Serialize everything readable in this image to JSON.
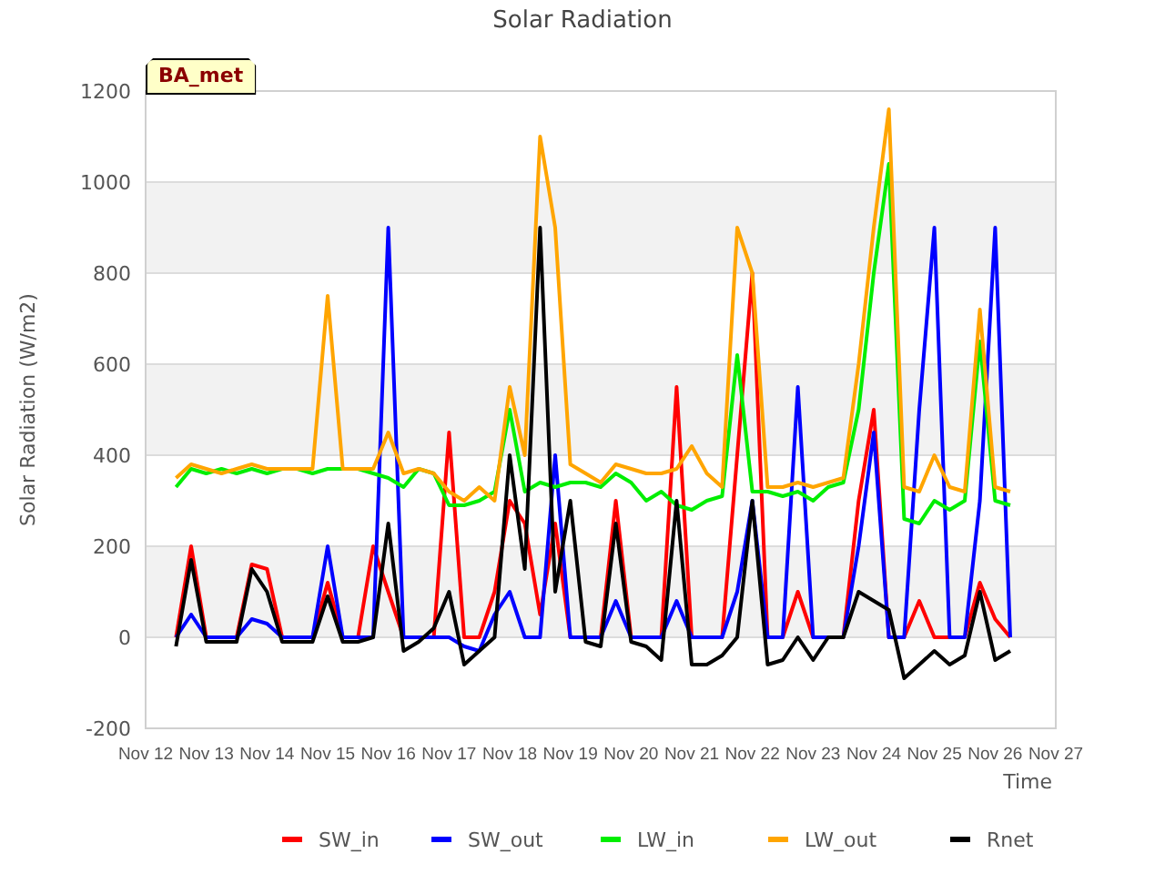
{
  "site_tag": "BA_met",
  "chart_data": {
    "type": "line",
    "title": "Solar Radiation",
    "xlabel": "Time",
    "ylabel": "Solar Radiation (W/m2)",
    "categories": [
      "Nov 12",
      null,
      null,
      null,
      "Nov 13",
      null,
      null,
      null,
      "Nov 14",
      null,
      null,
      null,
      "Nov 15",
      null,
      null,
      null,
      "Nov 16",
      null,
      null,
      null,
      "Nov 17",
      null,
      null,
      null,
      "Nov 18",
      null,
      null,
      null,
      "Nov 19",
      null,
      null,
      null,
      "Nov 20",
      null,
      null,
      null,
      "Nov 21",
      null,
      null,
      null,
      "Nov 22",
      null,
      null,
      null,
      "Nov 23",
      null,
      null,
      null,
      "Nov 24",
      null,
      null,
      null,
      "Nov 25",
      null,
      null,
      null,
      "Nov 26",
      null,
      null,
      null,
      "Nov 27"
    ],
    "series": [
      {
        "name": "SW_in",
        "color": "#ff0000",
        "values": [
          null,
          null,
          0,
          200,
          0,
          0,
          0,
          160,
          150,
          0,
          0,
          0,
          120,
          0,
          0,
          200,
          100,
          0,
          0,
          0,
          450,
          0,
          0,
          100,
          300,
          250,
          50,
          250,
          0,
          0,
          0,
          300,
          0,
          0,
          0,
          550,
          0,
          0,
          0,
          400,
          800,
          0,
          0,
          100,
          0,
          0,
          0,
          300,
          500,
          0,
          0,
          80,
          0,
          0,
          0,
          120,
          40,
          0,
          null,
          null,
          null
        ]
      },
      {
        "name": "SW_out",
        "color": "#0000ff",
        "values": [
          null,
          null,
          0,
          50,
          0,
          0,
          0,
          40,
          30,
          0,
          0,
          0,
          200,
          0,
          0,
          0,
          900,
          0,
          0,
          0,
          0,
          -20,
          -30,
          50,
          100,
          0,
          0,
          400,
          0,
          0,
          0,
          80,
          0,
          0,
          0,
          80,
          0,
          0,
          0,
          100,
          300,
          0,
          0,
          550,
          0,
          0,
          0,
          200,
          450,
          0,
          0,
          500,
          900,
          0,
          0,
          300,
          900,
          0,
          null,
          null,
          null
        ]
      },
      {
        "name": "LW_in",
        "color": "#00ee00",
        "values": [
          null,
          null,
          330,
          370,
          360,
          370,
          360,
          370,
          360,
          370,
          370,
          360,
          370,
          370,
          370,
          360,
          350,
          330,
          370,
          360,
          290,
          290,
          300,
          320,
          500,
          320,
          340,
          330,
          340,
          340,
          330,
          360,
          340,
          300,
          320,
          290,
          280,
          300,
          310,
          620,
          320,
          320,
          310,
          320,
          300,
          330,
          340,
          500,
          800,
          1040,
          260,
          250,
          300,
          280,
          300,
          650,
          300,
          290,
          null,
          null,
          null
        ]
      },
      {
        "name": "LW_out",
        "color": "#ffa500",
        "values": [
          null,
          null,
          350,
          380,
          370,
          360,
          370,
          380,
          370,
          370,
          370,
          370,
          750,
          370,
          370,
          370,
          450,
          360,
          370,
          360,
          320,
          300,
          330,
          300,
          550,
          400,
          1100,
          900,
          380,
          360,
          340,
          380,
          370,
          360,
          360,
          370,
          420,
          360,
          330,
          900,
          800,
          330,
          330,
          340,
          330,
          340,
          350,
          600,
          900,
          1160,
          330,
          320,
          400,
          330,
          320,
          720,
          330,
          320,
          null,
          null,
          null
        ]
      },
      {
        "name": "Rnet",
        "color": "#000000",
        "values": [
          null,
          null,
          -20,
          170,
          -10,
          -10,
          -10,
          150,
          100,
          -10,
          -10,
          -10,
          90,
          -10,
          -10,
          0,
          250,
          -30,
          -10,
          20,
          100,
          -60,
          -30,
          0,
          400,
          150,
          900,
          100,
          300,
          -10,
          -20,
          250,
          -10,
          -20,
          -50,
          300,
          -60,
          -60,
          -40,
          0,
          300,
          -60,
          -50,
          0,
          -50,
          0,
          0,
          100,
          80,
          60,
          -90,
          -60,
          -30,
          -60,
          -40,
          100,
          -50,
          -30,
          null,
          null,
          null
        ]
      }
    ],
    "grid": true,
    "legend": "bottom",
    "ylim": [
      -200,
      1200
    ],
    "yticks": [
      -200,
      0,
      200,
      400,
      600,
      800,
      1000,
      1200
    ]
  }
}
